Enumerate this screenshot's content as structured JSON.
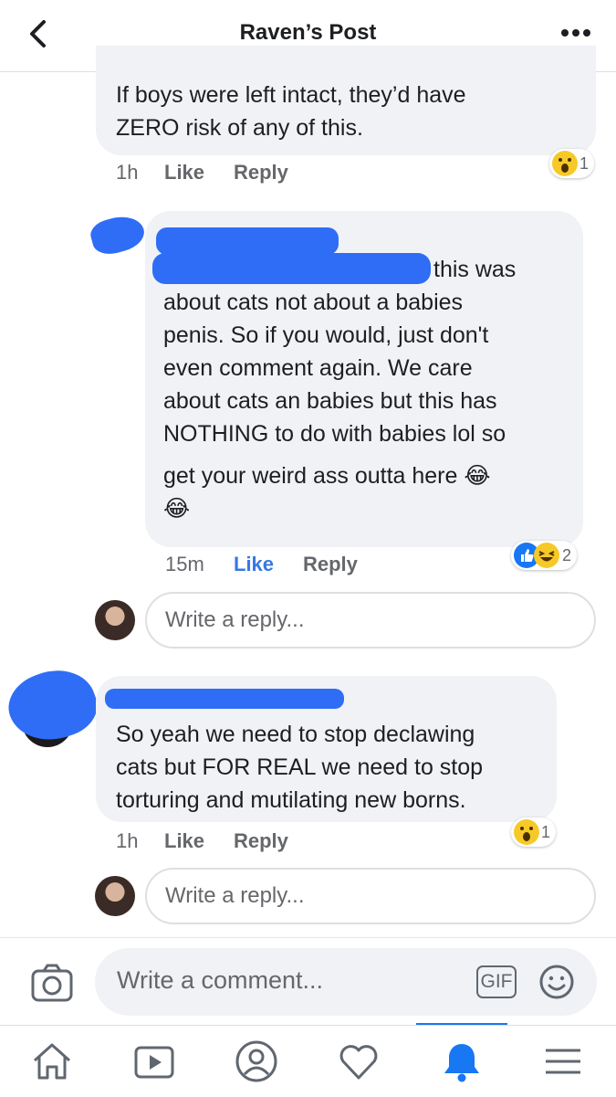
{
  "header": {
    "title": "Raven’s Post"
  },
  "comments": [
    {
      "text_lines": [
        "If boys were left intact, they’d have",
        "ZERO risk of any of this."
      ],
      "time": "1h",
      "like_label": "Like",
      "reply_label": "Reply",
      "reactions": {
        "icons": [
          "wow-emoji"
        ],
        "count": "1"
      }
    },
    {
      "text_lines": [
        "this was",
        "about cats not about a babies",
        "penis. So if you would, just don't",
        "even comment again. We care",
        "about cats an babies but this has",
        "NOTHING to do with babies lol so",
        "get your weird ass outta here 😂",
        "😂"
      ],
      "time": "15m",
      "like_label": "Like",
      "reply_label": "Reply",
      "reactions": {
        "icons": [
          "like-emoji",
          "haha-emoji"
        ],
        "count": "2"
      }
    },
    {
      "text_lines": [
        "So yeah we need to stop declawing",
        "cats but FOR REAL we need to stop",
        "torturing and mutilating new borns."
      ],
      "time": "1h",
      "like_label": "Like",
      "reply_label": "Reply",
      "reactions": {
        "icons": [
          "wow-emoji"
        ],
        "count": "1"
      }
    }
  ],
  "reply_box": {
    "placeholder": "Write a reply..."
  },
  "composer": {
    "placeholder": "Write a comment...",
    "gif_label": "GIF"
  },
  "tabbar": {
    "items": [
      "home-icon",
      "video-icon",
      "profile-icon",
      "heart-icon",
      "notifications-icon",
      "menu-icon"
    ],
    "active": "notifications-icon"
  },
  "colors": {
    "accent": "#1877f2",
    "bubble": "#f0f2f5",
    "scribble": "#2f6df6",
    "reaction_yellow": "#f7c928"
  }
}
